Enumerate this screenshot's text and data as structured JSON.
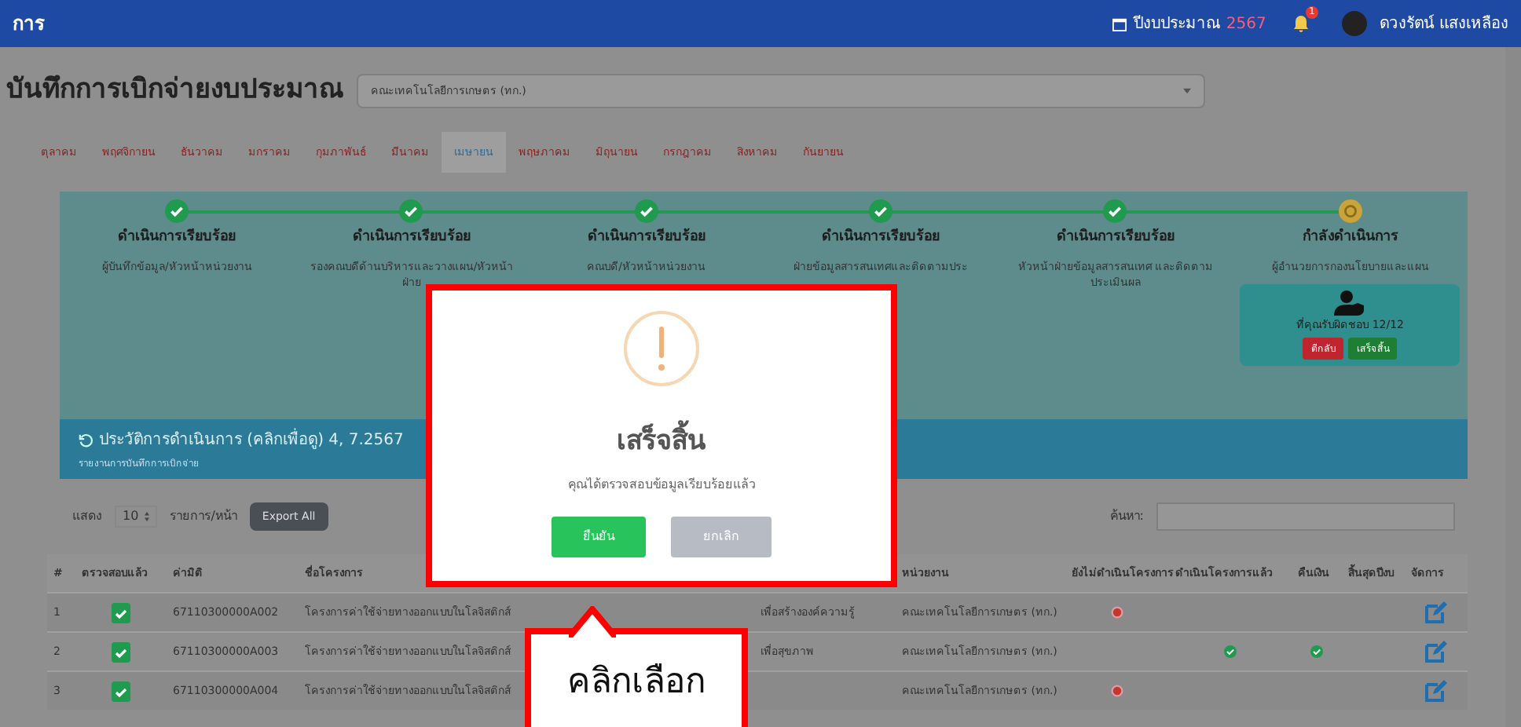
{
  "navbar": {
    "brand": "การ",
    "budget_year": "ปีงบประมาณ",
    "year_badge": "2567",
    "notification_count": "1",
    "user_name": "ดวงรัตน์ แสงเหลือง"
  },
  "page_title": "บันทึกการเบิกจ่ายงบประมาณ",
  "unit_select": {
    "value": "คณะเทคโนโลยีการเกษตร (ทก.)"
  },
  "month_tabs": [
    {
      "label": "ตุลาคม",
      "selected": false
    },
    {
      "label": "พฤศจิกายน",
      "selected": false
    },
    {
      "label": "ธันวาคม",
      "selected": false
    },
    {
      "label": "มกราคม",
      "selected": false
    },
    {
      "label": "กุมภาพันธ์",
      "selected": false
    },
    {
      "label": "มีนาคม",
      "selected": false
    },
    {
      "label": "เมษายน",
      "selected": true
    },
    {
      "label": "พฤษภาคม",
      "selected": false
    },
    {
      "label": "มิถุนายน",
      "selected": false
    },
    {
      "label": "กรกฎาคม",
      "selected": false
    },
    {
      "label": "สิงหาคม",
      "selected": false
    },
    {
      "label": "กันยายน",
      "selected": false
    }
  ],
  "steps": [
    {
      "completed": true,
      "title": "ดำเนินการเรียบร้อย",
      "role": "ผู้บันทึกข้อมูล/หัวหน้าหน่วยงาน"
    },
    {
      "completed": true,
      "title": "ดำเนินการเรียบร้อย",
      "role": "รองคณบดีด้านบริหารและวางแผน/หัวหน้าฝ่าย"
    },
    {
      "completed": true,
      "title": "ดำเนินการเรียบร้อย",
      "role": "คณบดี/หัวหน้าหน่วยงาน"
    },
    {
      "completed": true,
      "title": "ดำเนินการเรียบร้อย",
      "role": "ฝ่ายข้อมูลสารสนเทศและติดตามประ"
    },
    {
      "completed": true,
      "title": "ดำเนินการเรียบร้อย",
      "role": "หัวหน้าฝ่ายข้อมูลสารสนเทศ และติดตามประเมินผล"
    },
    {
      "completed": false,
      "title": "กำลังดำเนินการ",
      "role": "ผู้อำนวยการกองนโยบายและแผน",
      "card": {
        "text": "ที่คุณรับผิดชอบ 12/12",
        "reject": "ตีกลับ",
        "finish": "เสร็จสิ้น"
      }
    }
  ],
  "history_bar": {
    "title": "ประวัติการดำเนินการ (คลิกเพื่อดู) 4, 7.2567",
    "subtitle": "รายงานการบันทึกการเบิกจ่าย"
  },
  "table_controls": {
    "show_label": "แสดง",
    "page_size": "10",
    "per_page_label": "รายการ/หน้า",
    "export_button": "Export All",
    "search_label": "ค้นหา:"
  },
  "table": {
    "columns": [
      "#",
      "ตรวจสอบแล้ว",
      "ค่ามิติ",
      "ชื่อโครงการ",
      "หน่วยงาน",
      "ยังไม่ดำเนินโครงการ",
      "ดำเนินโครงการแล้ว",
      "คืนเงิน",
      "สิ้นสุดปีงบ",
      "จัดการ"
    ],
    "rows": [
      {
        "number": "1",
        "checked": true,
        "code": "67110300000A002",
        "project": [
          "โครงการค่าใช้จ่ายทางออกแบบในโลจิสติกส์",
          "เพื่อสร้างองค์ความรู้"
        ],
        "unit": "คณะเทคโนโลยีการเกษตร (ทก.)",
        "not_started": true,
        "done": false,
        "refunded": false,
        "closed": false
      },
      {
        "number": "2",
        "checked": true,
        "code": "67110300000A003",
        "project": [
          "โครงการค่าใช้จ่ายทางออกแบบในโลจิสติกส์",
          "เพื่อสุขภาพ"
        ],
        "unit": "คณะเทคโนโลยีการเกษตร (ทก.)",
        "not_started": false,
        "done": true,
        "refunded": true,
        "closed": false
      },
      {
        "number": "3",
        "checked": true,
        "code": "67110300000A004",
        "project": [
          "โครงการค่าใช้จ่ายทางออกแบบในโลจิสติกส์"
        ],
        "unit": "คณะเทคโนโลยีการเกษตร (ทก.)",
        "not_started": true,
        "done": false,
        "refunded": false,
        "closed": false
      }
    ]
  },
  "dialog": {
    "title": "เสร็จสิ้น",
    "message": "คุณได้ตรวจสอบข้อมูลเรียบร้อยแล้ว",
    "confirm": "ยืนยัน",
    "cancel": "ยกเลิก"
  },
  "callout": {
    "text": "คลิกเลือก"
  }
}
